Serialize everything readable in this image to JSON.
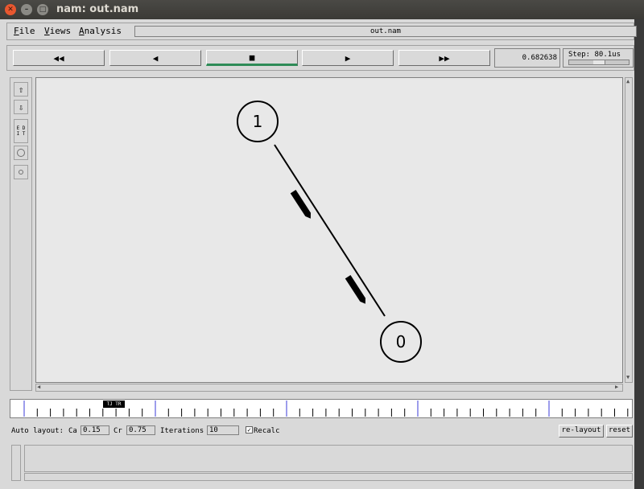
{
  "window": {
    "title": "nam: out.nam"
  },
  "menu": {
    "file_first": "F",
    "file_rest": "ile",
    "views_first": "V",
    "views_rest": "iews",
    "analysis_first": "A",
    "analysis_rest": "nalysis"
  },
  "file_name": "out.nam",
  "controls": {
    "rewind": "◀◀",
    "back": "◀",
    "stop": "■",
    "play": "▶",
    "fast_forward": "▶▶",
    "active": "stop"
  },
  "time": "0.682638",
  "step": {
    "label": "Step: 80.1us"
  },
  "tools": {
    "zoom_in": "⇧",
    "zoom_out": "⇩",
    "edit_line1": "E D",
    "edit_line2": "I T"
  },
  "nodes": [
    {
      "label": "1"
    },
    {
      "label": "0"
    }
  ],
  "timeline": {
    "marker": "TJ TR"
  },
  "auto_layout": {
    "label": "Auto layout:",
    "ca_label": "Ca",
    "ca_value": "0.15",
    "cr_label": "Cr",
    "cr_value": "0.75",
    "iterations_label": "Iterations",
    "iterations_value": "10",
    "recalc_label": "Recalc",
    "recalc_checked": "✓",
    "relayout_button": "re-layout",
    "reset_button": "reset"
  },
  "colors": {
    "active_indicator": "#2e8b57",
    "timeline_major": "#3b3bd8"
  }
}
